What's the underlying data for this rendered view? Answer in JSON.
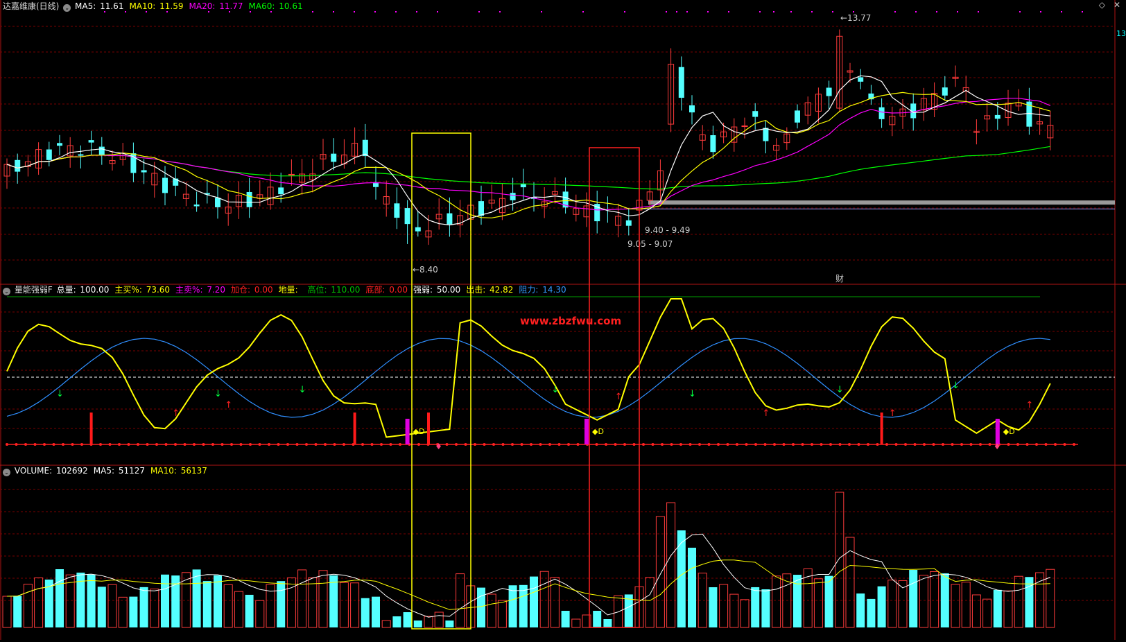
{
  "price_panel": {
    "stock_name": "达嘉维康(日线)",
    "indicators": [
      {
        "label": "MA5:",
        "value": "11.61",
        "color": "#ffffff"
      },
      {
        "label": "MA10:",
        "value": "11.59",
        "color": "#ffff00"
      },
      {
        "label": "MA20:",
        "value": "11.77",
        "color": "#ff00ff"
      },
      {
        "label": "MA60:",
        "value": "10.61",
        "color": "#00ff00"
      }
    ],
    "annotations": {
      "high": "13.77",
      "low": "8.40",
      "level1": "9.40 - 9.49",
      "level2": "9.05 - 9.07",
      "event_tag": "财"
    },
    "right_axis_label": "13"
  },
  "indicator_panel": {
    "name": "量能强弱F",
    "fields": [
      {
        "label": "总量:",
        "value": "100.00",
        "label_color": "#ffffff",
        "value_color": "#ffffff"
      },
      {
        "label": "主买%:",
        "value": "73.60",
        "label_color": "#ffff00",
        "value_color": "#ffff00"
      },
      {
        "label": "主卖%:",
        "value": "7.20",
        "label_color": "#ff00ff",
        "value_color": "#ff00ff"
      },
      {
        "label": "加仓:",
        "value": "0.00",
        "label_color": "#ff2020",
        "value_color": "#ff2020"
      },
      {
        "label": "地量:",
        "value": "",
        "label_color": "#ffff00",
        "value_color": "#ffff00"
      },
      {
        "label": "高位:",
        "value": "110.00",
        "label_color": "#00c000",
        "value_color": "#00c000"
      },
      {
        "label": "底部:",
        "value": "0.00",
        "label_color": "#ff2020",
        "value_color": "#ff2020"
      },
      {
        "label": "强弱:",
        "value": "50.00",
        "label_color": "#ffffff",
        "value_color": "#ffffff"
      },
      {
        "label": "出击:",
        "value": "42.82",
        "label_color": "#ffff00",
        "value_color": "#ffff00"
      },
      {
        "label": "阻力:",
        "value": "14.30",
        "label_color": "#3399ff",
        "value_color": "#3399ff"
      }
    ],
    "watermark": "www.zbzfwu.com",
    "marker_letter": "D"
  },
  "volume_panel": {
    "fields": [
      {
        "label": "VOLUME:",
        "value": "102692",
        "color": "#ffffff"
      },
      {
        "label": "MA5:",
        "value": "51127",
        "color": "#ffffff"
      },
      {
        "label": "MA10:",
        "value": "56137",
        "color": "#ffff00"
      }
    ]
  },
  "colors": {
    "up": "#ff3b3b",
    "down": "#54ffff",
    "ma5": "#ffffff",
    "ma10": "#ffff00",
    "ma20": "#ff00ff",
    "ma60": "#00ff00",
    "strength": "#ffff00",
    "resistance": "#2f8fff",
    "highlight_box_1": "#ffff00",
    "highlight_box_2": "#ff2020"
  },
  "icons": [
    "collapse-circle-icon",
    "window-restore-icon",
    "close-icon"
  ]
}
